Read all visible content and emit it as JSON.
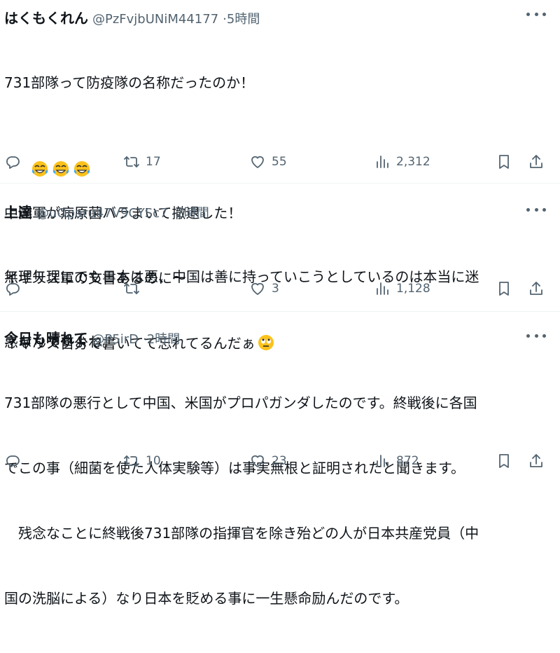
{
  "tweets": [
    {
      "name": "はくもくれん",
      "handle": "@PzFvjbUNiM44177",
      "time": "5時間",
      "lines": [
        "731部隊って防疫隊の名称だったのか！",
        "",
        "中国軍が病原菌バラまいて撤退した！",
        "イギリス軍の文書あるのに～",
        "イギリス自分で書いてて忘れてるんだぁ"
      ],
      "emoji_line": [
        "tears-of-joy",
        "tears-of-joy",
        "tears-of-joy"
      ],
      "trailing_emoji": "rolling-eyes",
      "replies": "",
      "reposts": "17",
      "likes": "55",
      "views": "2,312"
    },
    {
      "name": "上達",
      "handle": "@uOparu47V9CYSc7",
      "time": "2時間",
      "lines": [
        "無理矢理にでも日本は悪、中国は善に持っていこうとしているのは本当に迷",
        "惑なんですよね。"
      ],
      "replies": "",
      "reposts": "",
      "likes": "3",
      "views": "1,128"
    },
    {
      "name": "今日も晴れて",
      "handle": "@P5irD",
      "time": "2時間",
      "lines": [
        "731部隊の悪行として中国、米国がプロパガンダしたのです。終戦後に各国",
        "でこの事（細菌を使た人体実験等）は事実無根と証明されたと聞きます。",
        "　残念なことに終戦後731部隊の指揮官を除き殆どの人が日本共産党員（中",
        "国の洗脳による）なり日本を貶める事に一生懸命励んだのです。"
      ],
      "replies": "",
      "reposts": "10",
      "likes": "23",
      "views": "872"
    }
  ],
  "colors": {
    "text": "#0f1419",
    "muted": "#536471",
    "divider": "#eff3f4"
  }
}
